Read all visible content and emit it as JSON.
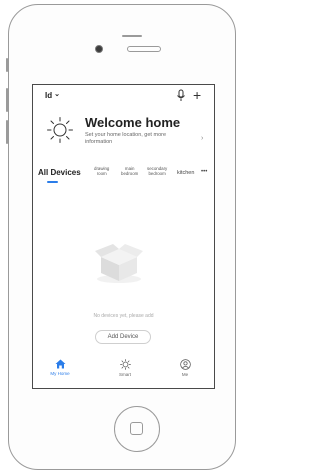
{
  "header": {
    "home_name": "Id",
    "dropdown_glyph": "⌄",
    "add_glyph": "+"
  },
  "welcome": {
    "title": "Welcome home",
    "subtitle": "Set your home location, get more information",
    "arrow": "›"
  },
  "tabs": {
    "active": "All Devices",
    "rooms": [
      {
        "line1": "drawing",
        "line2": "room"
      },
      {
        "line1": "main",
        "line2": "bedroom"
      },
      {
        "line1": "secondary",
        "line2": "bedroom"
      }
    ],
    "kitchen": "kitchen",
    "more": "•••"
  },
  "empty_state": {
    "message": "No devices yet, please add",
    "add_button": "Add Device"
  },
  "bottom_nav": {
    "items": [
      {
        "label": "My Home",
        "icon": "home-icon"
      },
      {
        "label": "Smart",
        "icon": "sun-icon"
      },
      {
        "label": "Me",
        "icon": "profile-icon"
      }
    ]
  },
  "colors": {
    "accent": "#2b7de9",
    "frame": "#9a9a9a"
  }
}
